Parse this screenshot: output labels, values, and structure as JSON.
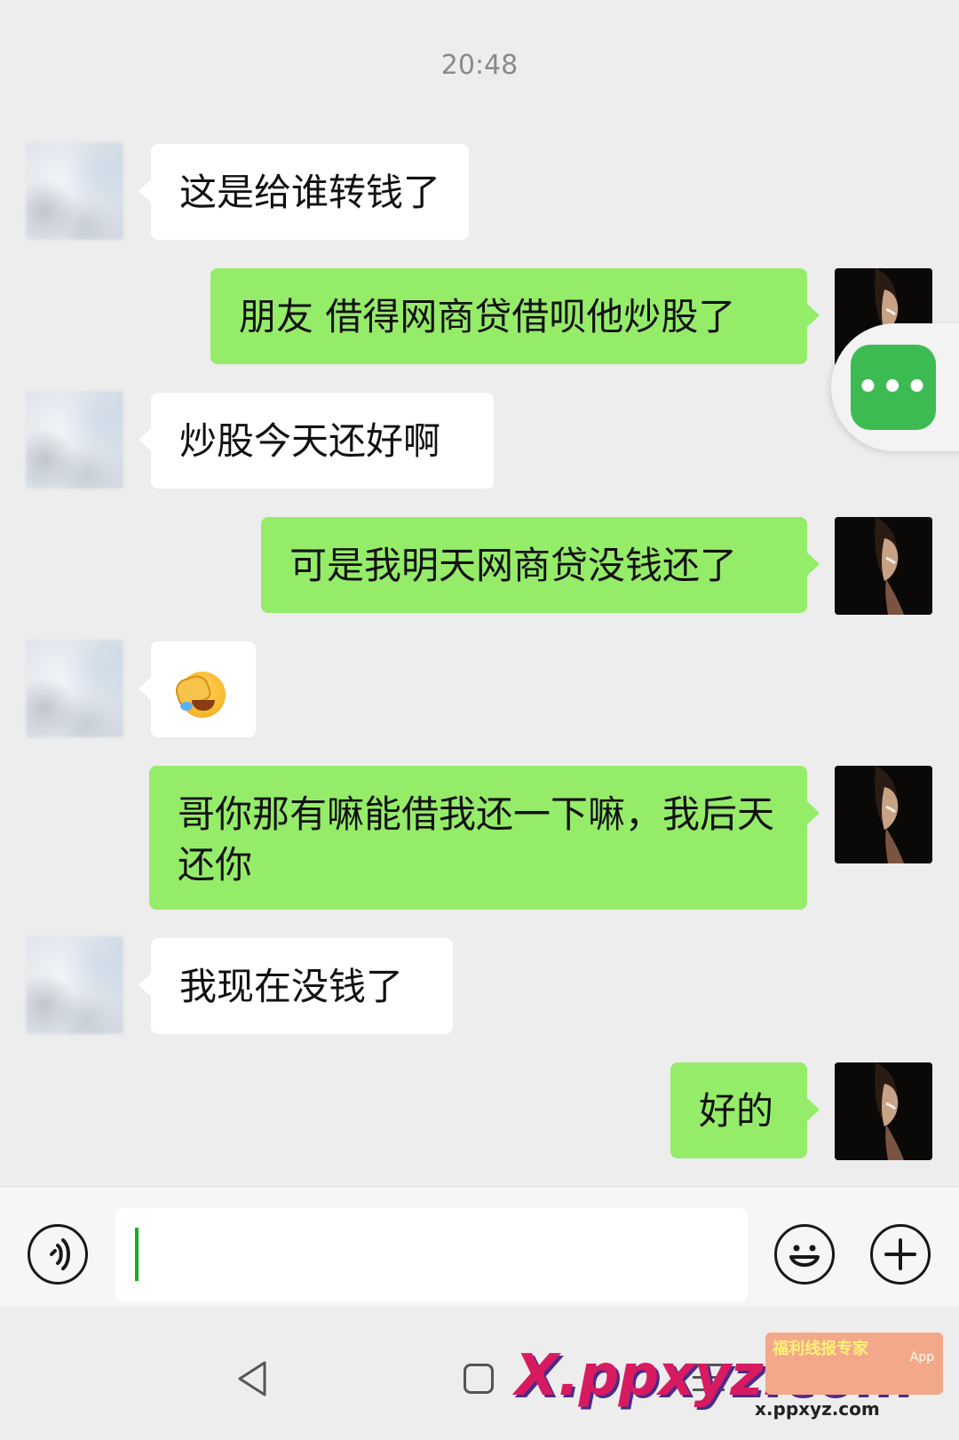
{
  "timestamp": "20:48",
  "messages": [
    {
      "side": "in",
      "text": "这是给谁转钱了"
    },
    {
      "side": "out",
      "text": "朋友 借得网商贷借呗他炒股了"
    },
    {
      "side": "in",
      "text": "炒股今天还好啊"
    },
    {
      "side": "out",
      "text": "可是我明天网商贷没钱还了"
    },
    {
      "side": "in",
      "emoji": "face-palm-crying-emoji"
    },
    {
      "side": "out",
      "text": "哥你那有嘛能借我还一下嘛，我后天还你"
    },
    {
      "side": "in",
      "text": "我现在没钱了"
    },
    {
      "side": "out",
      "text": "好的"
    }
  ],
  "floating_menu": {
    "label": "•••"
  },
  "input_bar": {
    "voice_icon": "voice-icon",
    "emoji_icon": "smiley-icon",
    "plus_icon": "plus-icon",
    "text_value": ""
  },
  "nav_bar": {
    "back_icon": "back-triangle-icon",
    "home_icon": "home-square-icon",
    "recent_icon": "recent-apps-icon"
  },
  "watermark": {
    "logo_text": "X.ppxyz.com",
    "badge_title": "福利线报专家",
    "badge_sub": "App",
    "url_text": "x.ppxyz.com"
  },
  "colors": {
    "background": "#EDEDED",
    "incoming_bubble": "#FFFFFF",
    "outgoing_bubble": "#95EC69",
    "accent_green": "#3DBB53"
  }
}
